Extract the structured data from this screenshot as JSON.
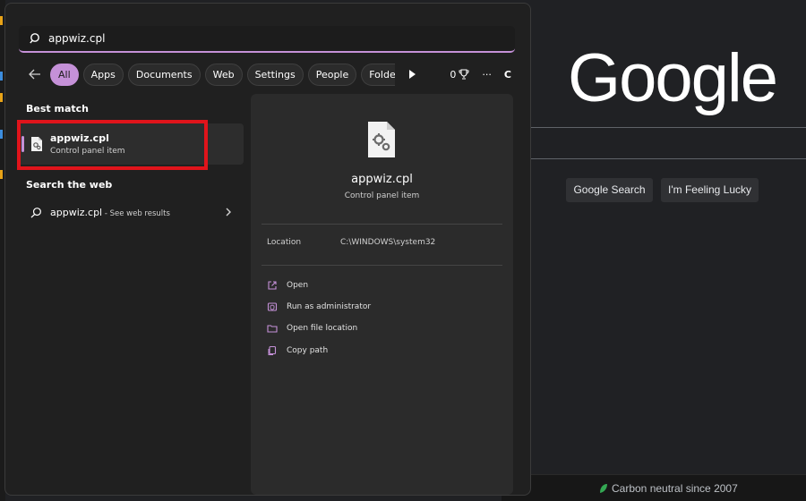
{
  "google": {
    "logo": "Google",
    "search_button": "Google Search",
    "lucky_button": "I'm Feeling Lucky",
    "footer_text": "Carbon neutral since 2007"
  },
  "search": {
    "query": "appwiz.cpl"
  },
  "filters": {
    "chips": [
      "All",
      "Apps",
      "Documents",
      "Web",
      "Settings",
      "People",
      "Folde"
    ],
    "active": "All",
    "points": "0",
    "more": "···",
    "profile_initial": "C"
  },
  "results": {
    "best_match_label": "Best match",
    "best_match": {
      "title": "appwiz.cpl",
      "subtitle": "Control panel item"
    },
    "web_label": "Search the web",
    "web_item": {
      "query": "appwiz.cpl",
      "suffix": " - See web results"
    }
  },
  "details": {
    "title": "appwiz.cpl",
    "subtitle": "Control panel item",
    "location_label": "Location",
    "location_value": "C:\\WINDOWS\\system32",
    "actions": [
      {
        "label": "Open",
        "icon": "open-icon"
      },
      {
        "label": "Run as administrator",
        "icon": "shield-icon"
      },
      {
        "label": "Open file location",
        "icon": "folder-icon"
      },
      {
        "label": "Copy path",
        "icon": "copy-icon"
      }
    ]
  },
  "colors": {
    "accent": "#c591d8",
    "highlight": "#e0141b",
    "panel_bg": "#202020",
    "google_bg": "#202124"
  }
}
